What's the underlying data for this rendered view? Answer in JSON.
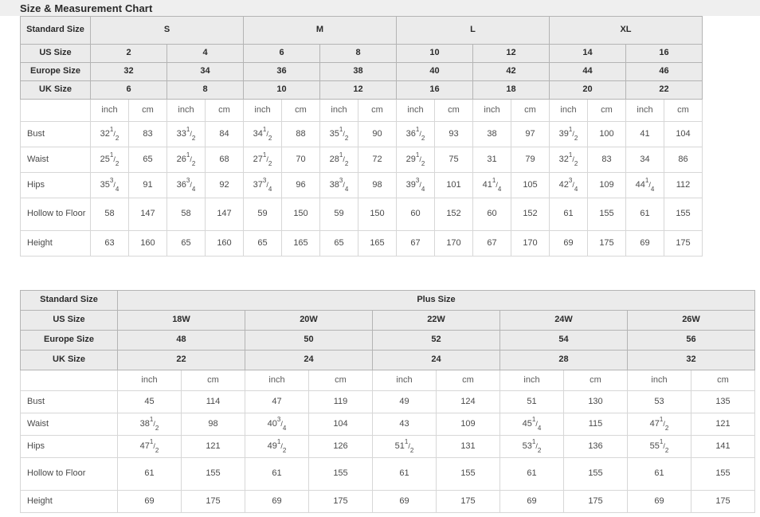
{
  "header": {
    "title": "Size & Measurement Chart"
  },
  "table1": {
    "corner_label": "Standard Size",
    "size_groups": [
      {
        "label": "S",
        "span": 4
      },
      {
        "label": "M",
        "span": 4
      },
      {
        "label": "L",
        "span": 4
      },
      {
        "label": "XL",
        "span": 4
      }
    ],
    "spec_rows": [
      {
        "label": "US Size",
        "values": [
          "2",
          "4",
          "6",
          "8",
          "10",
          "12",
          "14",
          "16"
        ]
      },
      {
        "label": "Europe Size",
        "values": [
          "32",
          "34",
          "36",
          "38",
          "40",
          "42",
          "44",
          "46"
        ]
      },
      {
        "label": "UK Size",
        "values": [
          "6",
          "8",
          "10",
          "12",
          "16",
          "18",
          "20",
          "22"
        ]
      }
    ],
    "unit_row": {
      "label": "",
      "units": [
        "inch",
        "cm",
        "inch",
        "cm",
        "inch",
        "cm",
        "inch",
        "cm",
        "inch",
        "cm",
        "inch",
        "cm",
        "inch",
        "cm",
        "inch",
        "cm"
      ]
    },
    "measure_rows": [
      {
        "label": "Bust",
        "cells": [
          {
            "whole": "32",
            "num": "1",
            "den": "2"
          },
          {
            "whole": "83"
          },
          {
            "whole": "33",
            "num": "1",
            "den": "2"
          },
          {
            "whole": "84"
          },
          {
            "whole": "34",
            "num": "1",
            "den": "2"
          },
          {
            "whole": "88"
          },
          {
            "whole": "35",
            "num": "1",
            "den": "2"
          },
          {
            "whole": "90"
          },
          {
            "whole": "36",
            "num": "1",
            "den": "2"
          },
          {
            "whole": "93"
          },
          {
            "whole": "38"
          },
          {
            "whole": "97"
          },
          {
            "whole": "39",
            "num": "1",
            "den": "2"
          },
          {
            "whole": "100"
          },
          {
            "whole": "41"
          },
          {
            "whole": "104"
          }
        ]
      },
      {
        "label": "Waist",
        "cells": [
          {
            "whole": "25",
            "num": "1",
            "den": "2"
          },
          {
            "whole": "65"
          },
          {
            "whole": "26",
            "num": "1",
            "den": "2"
          },
          {
            "whole": "68"
          },
          {
            "whole": "27",
            "num": "1",
            "den": "2"
          },
          {
            "whole": "70"
          },
          {
            "whole": "28",
            "num": "1",
            "den": "2"
          },
          {
            "whole": "72"
          },
          {
            "whole": "29",
            "num": "1",
            "den": "2"
          },
          {
            "whole": "75"
          },
          {
            "whole": "31"
          },
          {
            "whole": "79"
          },
          {
            "whole": "32",
            "num": "1",
            "den": "2"
          },
          {
            "whole": "83"
          },
          {
            "whole": "34"
          },
          {
            "whole": "86"
          }
        ]
      },
      {
        "label": "Hips",
        "cells": [
          {
            "whole": "35",
            "num": "3",
            "den": "4"
          },
          {
            "whole": "91"
          },
          {
            "whole": "36",
            "num": "3",
            "den": "4"
          },
          {
            "whole": "92"
          },
          {
            "whole": "37",
            "num": "3",
            "den": "4"
          },
          {
            "whole": "96"
          },
          {
            "whole": "38",
            "num": "3",
            "den": "4"
          },
          {
            "whole": "98"
          },
          {
            "whole": "39",
            "num": "3",
            "den": "4"
          },
          {
            "whole": "101"
          },
          {
            "whole": "41",
            "num": "1",
            "den": "4"
          },
          {
            "whole": "105"
          },
          {
            "whole": "42",
            "num": "3",
            "den": "4"
          },
          {
            "whole": "109"
          },
          {
            "whole": "44",
            "num": "1",
            "den": "4"
          },
          {
            "whole": "112"
          }
        ]
      },
      {
        "label": "Hollow to Floor",
        "cells": [
          {
            "whole": "58"
          },
          {
            "whole": "147"
          },
          {
            "whole": "58"
          },
          {
            "whole": "147"
          },
          {
            "whole": "59"
          },
          {
            "whole": "150"
          },
          {
            "whole": "59"
          },
          {
            "whole": "150"
          },
          {
            "whole": "60"
          },
          {
            "whole": "152"
          },
          {
            "whole": "60"
          },
          {
            "whole": "152"
          },
          {
            "whole": "61"
          },
          {
            "whole": "155"
          },
          {
            "whole": "61"
          },
          {
            "whole": "155"
          }
        ]
      },
      {
        "label": "Height",
        "cells": [
          {
            "whole": "63"
          },
          {
            "whole": "160"
          },
          {
            "whole": "65"
          },
          {
            "whole": "160"
          },
          {
            "whole": "65"
          },
          {
            "whole": "165"
          },
          {
            "whole": "65"
          },
          {
            "whole": "165"
          },
          {
            "whole": "67"
          },
          {
            "whole": "170"
          },
          {
            "whole": "67"
          },
          {
            "whole": "170"
          },
          {
            "whole": "69"
          },
          {
            "whole": "175"
          },
          {
            "whole": "69"
          },
          {
            "whole": "175"
          }
        ]
      }
    ]
  },
  "table2": {
    "corner_label": "Standard Size",
    "group_label": "Plus Size",
    "spec_rows": [
      {
        "label": "US Size",
        "values": [
          "18W",
          "20W",
          "22W",
          "24W",
          "26W"
        ]
      },
      {
        "label": "Europe Size",
        "values": [
          "48",
          "50",
          "52",
          "54",
          "56"
        ]
      },
      {
        "label": "UK Size",
        "values": [
          "22",
          "24",
          "24",
          "28",
          "32"
        ]
      }
    ],
    "unit_row": {
      "label": "",
      "units": [
        "inch",
        "cm",
        "inch",
        "cm",
        "inch",
        "cm",
        "inch",
        "cm",
        "inch",
        "cm"
      ]
    },
    "measure_rows": [
      {
        "label": "Bust",
        "cells": [
          {
            "whole": "45"
          },
          {
            "whole": "114"
          },
          {
            "whole": "47"
          },
          {
            "whole": "119"
          },
          {
            "whole": "49"
          },
          {
            "whole": "124"
          },
          {
            "whole": "51"
          },
          {
            "whole": "130"
          },
          {
            "whole": "53"
          },
          {
            "whole": "135"
          }
        ]
      },
      {
        "label": "Waist",
        "cells": [
          {
            "whole": "38",
            "num": "1",
            "den": "2"
          },
          {
            "whole": "98"
          },
          {
            "whole": "40",
            "num": "3",
            "den": "4"
          },
          {
            "whole": "104"
          },
          {
            "whole": "43"
          },
          {
            "whole": "109"
          },
          {
            "whole": "45",
            "num": "1",
            "den": "4"
          },
          {
            "whole": "115"
          },
          {
            "whole": "47",
            "num": "1",
            "den": "2"
          },
          {
            "whole": "121"
          }
        ]
      },
      {
        "label": "Hips",
        "cells": [
          {
            "whole": "47",
            "num": "1",
            "den": "2"
          },
          {
            "whole": "121"
          },
          {
            "whole": "49",
            "num": "1",
            "den": "2"
          },
          {
            "whole": "126"
          },
          {
            "whole": "51",
            "num": "1",
            "den": "2"
          },
          {
            "whole": "131"
          },
          {
            "whole": "53",
            "num": "1",
            "den": "2"
          },
          {
            "whole": "136"
          },
          {
            "whole": "55",
            "num": "1",
            "den": "2"
          },
          {
            "whole": "141"
          }
        ]
      },
      {
        "label": "Hollow to Floor",
        "cells": [
          {
            "whole": "61"
          },
          {
            "whole": "155"
          },
          {
            "whole": "61"
          },
          {
            "whole": "155"
          },
          {
            "whole": "61"
          },
          {
            "whole": "155"
          },
          {
            "whole": "61"
          },
          {
            "whole": "155"
          },
          {
            "whole": "61"
          },
          {
            "whole": "155"
          }
        ]
      },
      {
        "label": "Height",
        "cells": [
          {
            "whole": "69"
          },
          {
            "whole": "175"
          },
          {
            "whole": "69"
          },
          {
            "whole": "175"
          },
          {
            "whole": "69"
          },
          {
            "whole": "175"
          },
          {
            "whole": "69"
          },
          {
            "whole": "175"
          },
          {
            "whole": "69"
          },
          {
            "whole": "175"
          }
        ]
      }
    ]
  },
  "colors": {
    "title_bar_bg": "#efefef",
    "header_cell_bg": "#ebebeb",
    "header_border": "#b4b4b4",
    "cell_border": "#d7d7d7",
    "text": "#4a4a4a",
    "header_text": "#2b2b2b"
  }
}
